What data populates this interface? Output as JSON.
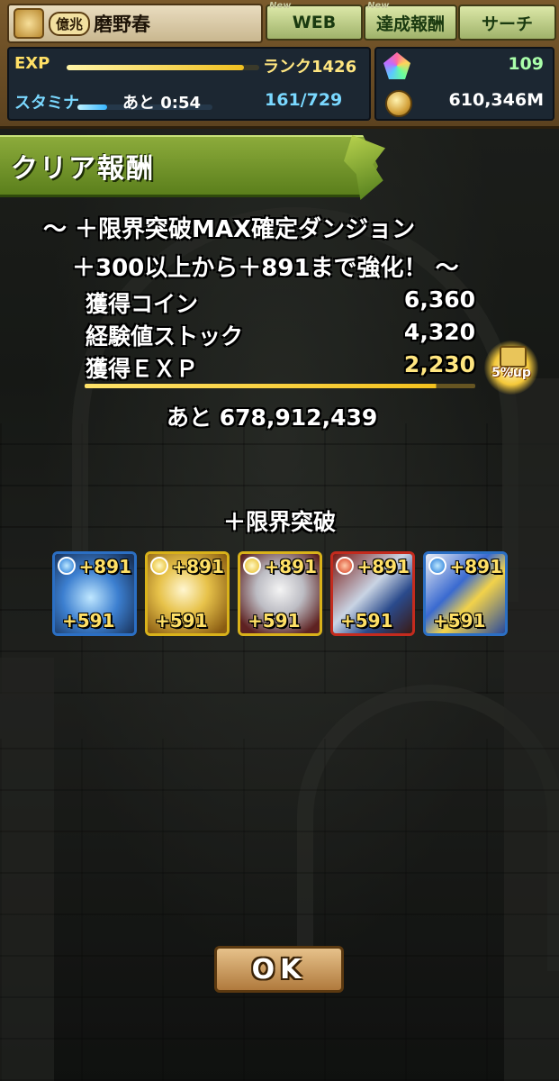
{
  "header": {
    "title_badge": "億兆",
    "player_name": "磨野春",
    "tabs": [
      {
        "label": "WEB",
        "badge": "New"
      },
      {
        "label": "達成報酬",
        "badge": "New"
      },
      {
        "label": "サーチ",
        "badge": ""
      }
    ],
    "exp": {
      "label": "EXP",
      "rank": "ランク1426",
      "fill": 0.92
    },
    "stamina": {
      "label": "スタミナ",
      "timer": "あと 0:54",
      "value": "161/729",
      "fill": 0.22
    },
    "magic_stones": "109",
    "coins": "610,346M"
  },
  "reward": {
    "title": "クリア報酬",
    "dungeon_line1": "～ ＋限界突破MAX確定ダンジョン",
    "dungeon_line2": "＋300以上から＋891まで強化！ ～",
    "rows": [
      {
        "label": "獲得コイン",
        "value": "6,360"
      },
      {
        "label": "経験値ストック",
        "value": "4,320"
      },
      {
        "label": "獲得ＥＸＰ",
        "value": "2,230"
      }
    ],
    "exp_fill": 0.9,
    "bonus": "5%up",
    "remaining": "あと 678,912,439"
  },
  "limit_break": {
    "title": "＋限界突破",
    "monsters": [
      {
        "attribute": "water",
        "plus_top": "+891",
        "plus_bottom": "+591"
      },
      {
        "attribute": "light",
        "plus_top": "+891",
        "plus_bottom": "+591"
      },
      {
        "attribute": "light",
        "plus_top": "+891",
        "plus_bottom": "+591"
      },
      {
        "attribute": "fire",
        "plus_top": "+891",
        "plus_bottom": "+591"
      },
      {
        "attribute": "water",
        "plus_top": "+891",
        "plus_bottom": "+591"
      }
    ]
  },
  "ok_label": "OK",
  "colors": {
    "exp_text": "#ffe680",
    "header_green": "#6f9228",
    "ok_button": "#c8955a"
  }
}
